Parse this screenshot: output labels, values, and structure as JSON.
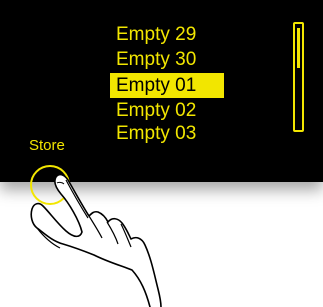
{
  "list": {
    "items": [
      {
        "label": "Empty 29",
        "selected": false
      },
      {
        "label": "Empty 30",
        "selected": false
      },
      {
        "label": "Empty 01",
        "selected": true
      },
      {
        "label": "Empty 02",
        "selected": false
      },
      {
        "label": "Empty 03",
        "selected": false
      }
    ]
  },
  "store": {
    "label": "Store",
    "button_icon": "circle-button-icon"
  },
  "colors": {
    "screen_background": "#000000",
    "accent": "#f2e600",
    "selected_text": "#000000"
  },
  "illustration": {
    "icon": "pointing-hand-icon"
  }
}
